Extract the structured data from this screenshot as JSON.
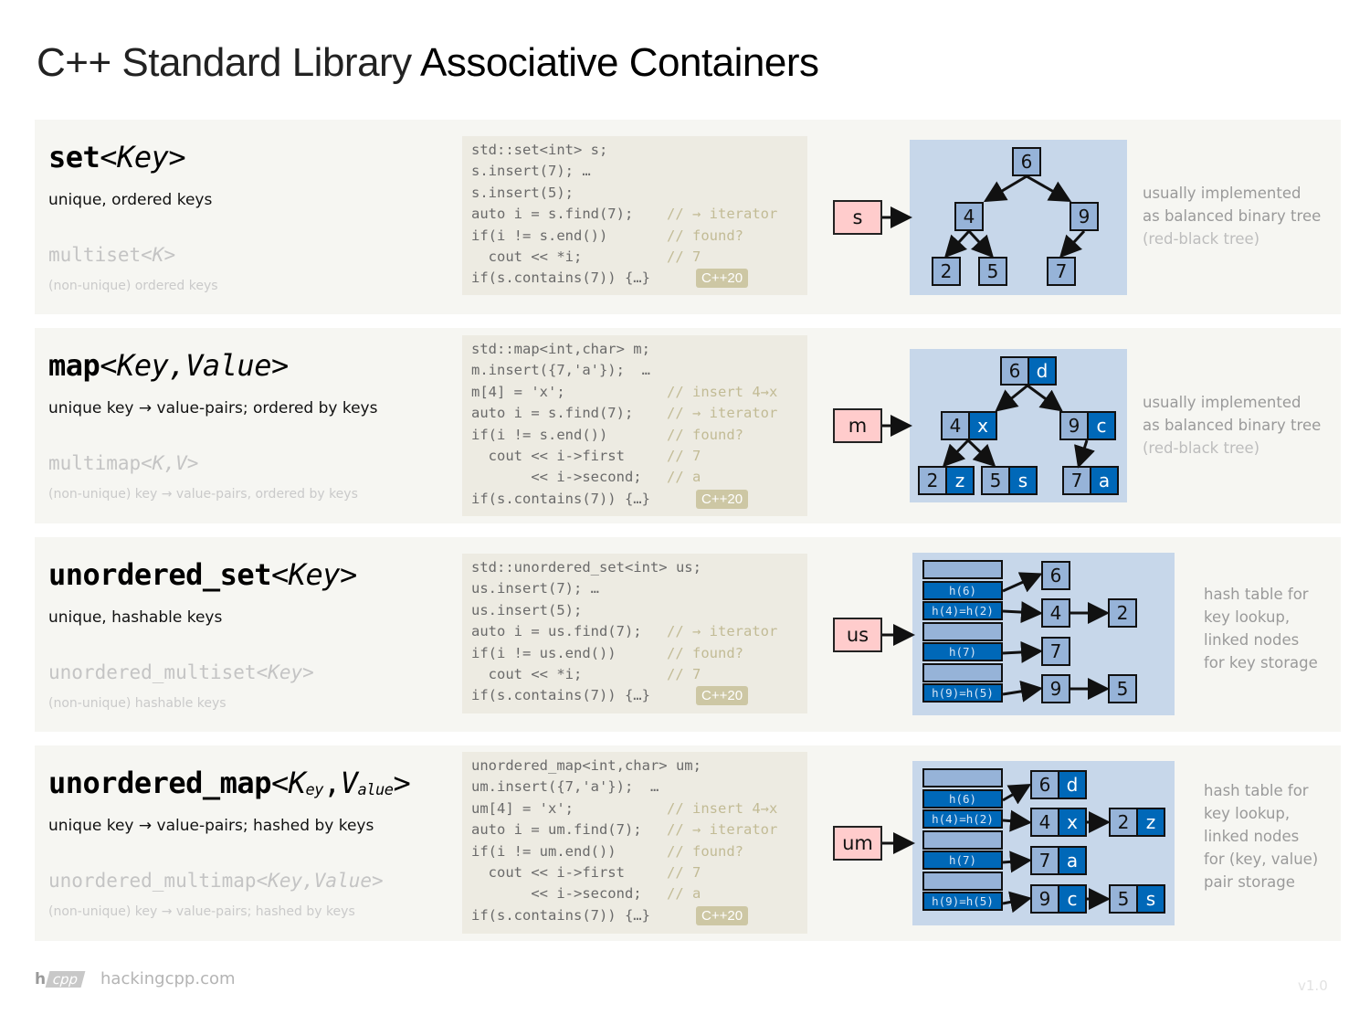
{
  "header": {
    "title_light": "C++ Standard Library ",
    "title_bold": "Associative Containers"
  },
  "sections": [
    {
      "id": "set",
      "name_main": "set",
      "name_params": "<Key>",
      "description": "unique, ordered keys",
      "multi_name": "multiset",
      "multi_params": "<K>",
      "multi_description": "(non-unique)  ordered keys",
      "code": [
        {
          "text": "std::set<int> s;",
          "comment": ""
        },
        {
          "text": "s.insert(7); …",
          "comment": ""
        },
        {
          "text": "s.insert(5);",
          "comment": ""
        },
        {
          "text": "auto i = s.find(7);",
          "comment": "// → iterator"
        },
        {
          "text": "if(i != s.end())",
          "comment": "// found?"
        },
        {
          "text": "  cout << *i;",
          "comment": "// 7"
        },
        {
          "text": "if(s.contains(7)) {…}",
          "comment": "",
          "badge": "C++20"
        }
      ],
      "handle": "s",
      "tree": {
        "root": "6",
        "left": "4",
        "right": "9",
        "ll": "2",
        "lr": "5",
        "rl": "7"
      },
      "note": [
        "usually implemented",
        "as balanced binary tree"
      ],
      "note_dim": "(red-black tree)"
    },
    {
      "id": "map",
      "name_main": "map",
      "name_params": "<Key,Value>",
      "description": "unique key → value-pairs; ordered by keys",
      "multi_name": "multimap",
      "multi_params": "<K,V>",
      "multi_description": "(non-unique)  key → value-pairs,  ordered by keys",
      "code": [
        {
          "text": "std::map<int,char> m;",
          "comment": ""
        },
        {
          "text": "m.insert({7,'a'});  …",
          "comment": ""
        },
        {
          "text": "m[4] = 'x';",
          "comment": "// insert 4→x"
        },
        {
          "text": "auto i = s.find(7);",
          "comment": "// → iterator"
        },
        {
          "text": "if(i != s.end())",
          "comment": "// found?"
        },
        {
          "text": "  cout << i->first",
          "comment": "// 7"
        },
        {
          "text": "       << i->second;",
          "comment": "// a"
        },
        {
          "text": "if(s.contains(7)) {…}",
          "comment": "",
          "badge": "C++20"
        }
      ],
      "handle": "m",
      "tree": {
        "root": [
          "6",
          "d"
        ],
        "left": [
          "4",
          "x"
        ],
        "right": [
          "9",
          "c"
        ],
        "ll": [
          "2",
          "z"
        ],
        "lr": [
          "5",
          "s"
        ],
        "rl": [
          "7",
          "a"
        ]
      },
      "note": [
        "usually implemented",
        "as balanced binary tree"
      ],
      "note_dim": "(red-black tree)"
    },
    {
      "id": "unordered_set",
      "name_main": "unordered_set",
      "name_params": "<Key>",
      "description": "unique, hashable keys",
      "multi_name": "unordered_multiset",
      "multi_params": "<Key>",
      "multi_description": "(non-unique)  hashable  keys",
      "code": [
        {
          "text": "std::unordered_set<int> us;",
          "comment": ""
        },
        {
          "text": "us.insert(7); …",
          "comment": ""
        },
        {
          "text": "us.insert(5);",
          "comment": ""
        },
        {
          "text": "auto i = us.find(7);",
          "comment": "// → iterator"
        },
        {
          "text": "if(i != us.end())",
          "comment": "// found?"
        },
        {
          "text": "  cout << *i;",
          "comment": "// 7"
        },
        {
          "text": "if(s.contains(7)) {…}",
          "comment": "",
          "badge": "C++20"
        }
      ],
      "handle": "us",
      "buckets": [
        "",
        "h(6)",
        "h(4)=h(2)",
        "",
        "h(7)",
        "",
        "h(9)=h(5)"
      ],
      "chains": [
        [
          "6"
        ],
        [
          "4",
          "2"
        ],
        [
          "7"
        ],
        [
          "9",
          "5"
        ]
      ],
      "note": [
        "hash table for",
        "key lookup,",
        "linked nodes",
        "for key storage"
      ]
    },
    {
      "id": "unordered_map",
      "name_main": "unordered_map",
      "name_params_k": "K",
      "name_params_k_sub": "ey",
      "name_params_v": "V",
      "name_params_v_sub": "alue",
      "description": "unique key → value-pairs; hashed by keys",
      "multi_name": "unordered_multimap",
      "multi_params": "<Key,Value>",
      "multi_description": "(non-unique)  key → value-pairs;  hashed  by keys",
      "code": [
        {
          "text": "unordered_map<int,char> um;",
          "comment": ""
        },
        {
          "text": "um.insert({7,'a'});  …",
          "comment": ""
        },
        {
          "text": "um[4] = 'x';",
          "comment": "// insert 4→x"
        },
        {
          "text": "auto i = um.find(7);",
          "comment": "// → iterator"
        },
        {
          "text": "if(i != um.end())",
          "comment": "// found?"
        },
        {
          "text": "  cout << i->first",
          "comment": "// 7"
        },
        {
          "text": "       << i->second;",
          "comment": "// a"
        },
        {
          "text": "if(s.contains(7)) {…}",
          "comment": "",
          "badge": "C++20"
        }
      ],
      "handle": "um",
      "buckets": [
        "",
        "h(6)",
        "h(4)=h(2)",
        "",
        "h(7)",
        "",
        "h(9)=h(5)"
      ],
      "chains": [
        [
          [
            "6",
            "d"
          ]
        ],
        [
          [
            "4",
            "x"
          ],
          [
            "2",
            "z"
          ]
        ],
        [
          [
            "7",
            "a"
          ]
        ],
        [
          [
            "9",
            "c"
          ],
          [
            "5",
            "s"
          ]
        ]
      ],
      "note": [
        "hash table for",
        "key lookup,",
        "linked nodes",
        "for (key, value)",
        "pair storage"
      ]
    }
  ],
  "footer": {
    "logo_h": "h",
    "logo_cpp": "cpp",
    "site": "hackingcpp.com",
    "version": "v1.0"
  },
  "colors": {
    "panel_bg": "#f6f6f2",
    "code_bg": "#edebe2",
    "diagram_bg": "#c7d7ea",
    "node_key": "#96b3d8",
    "node_value": "#0068b8",
    "handle_bg": "#ffcccc",
    "badge_bg": "#cdc7a4"
  }
}
